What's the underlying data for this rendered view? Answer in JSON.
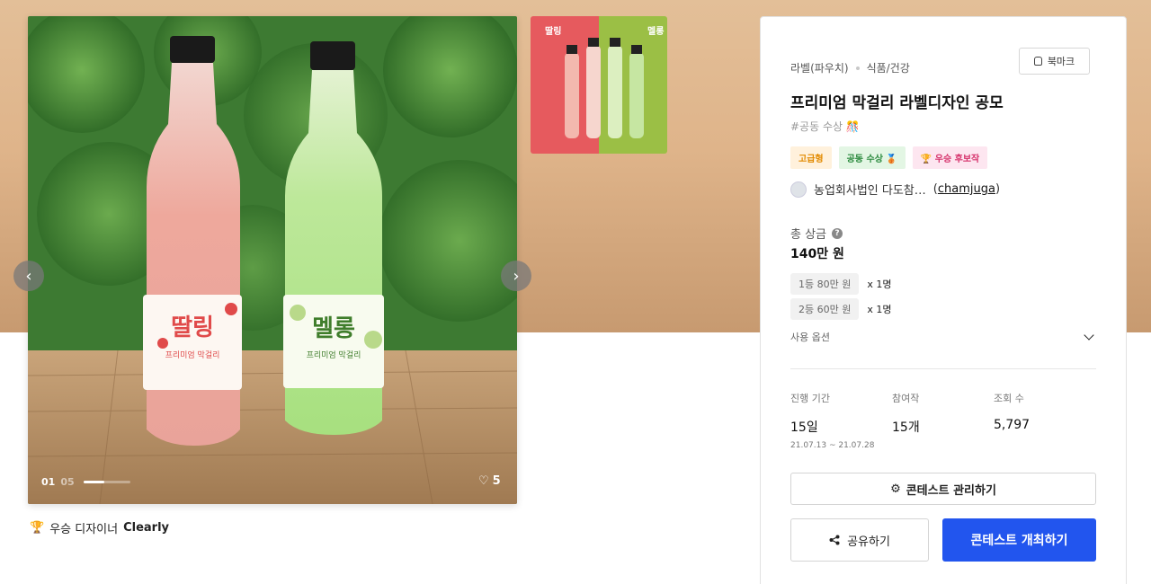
{
  "gallery": {
    "current": "01",
    "total": "05",
    "progress": 0.45,
    "likes": "5",
    "main_label_left": "딸링",
    "main_label_right": "멜롱",
    "main_label_left_sub": "프리미엄 막걸리",
    "main_label_right_sub": "프리미엄 막걸리",
    "thumb_label_left": "딸링",
    "thumb_label_right": "멜롱"
  },
  "winner": {
    "prefix": "우승 디자이너",
    "name": "Clearly"
  },
  "card": {
    "category": "라벨(파우치)",
    "subcategory": "식품/건강",
    "bookmark_label": "북마크",
    "title": "프리미엄 막걸리 라벨디자인 공모",
    "hashtag": "#공동 수상 🎊",
    "tags": [
      "고급형",
      "공동 수상 🥉",
      "🏆 우승 후보작"
    ],
    "host_name": "농업회사법인 다도참…",
    "host_handle": "chamjuga",
    "prize_label": "총 상금",
    "prize_help": "?",
    "prize_total": "140만 원",
    "ranks": [
      {
        "label": "1등 80만 원",
        "count": "x 1명"
      },
      {
        "label": "2등 60만 원",
        "count": "x 1명"
      }
    ],
    "options_label": "사용 옵션",
    "stats": [
      {
        "label": "진행 기간",
        "value": "15일",
        "sub": "21.07.13 ~ 21.07.28"
      },
      {
        "label": "참여작",
        "value": "15개",
        "sub": ""
      },
      {
        "label": "조회 수",
        "value": "5,797",
        "sub": ""
      }
    ],
    "manage_label": "콘테스트 관리하기",
    "share_label": "공유하기",
    "host_contest_label": "콘테스트 개최하기"
  },
  "colors": {
    "accent": "#2255ee",
    "hero_bg": "#dfb48a"
  }
}
